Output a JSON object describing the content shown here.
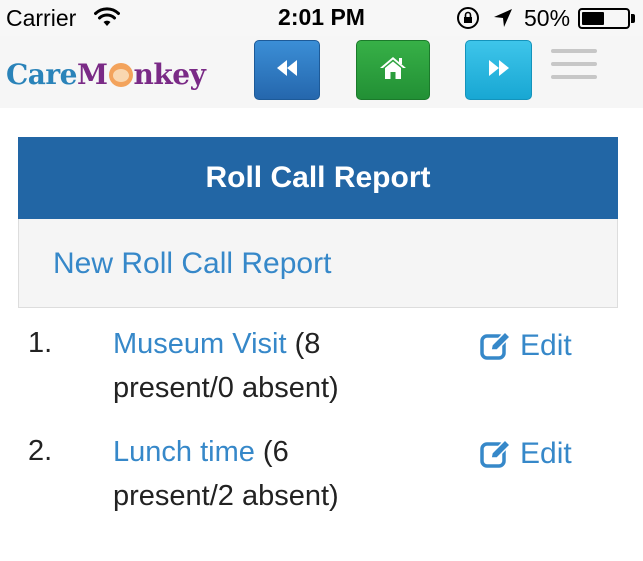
{
  "status_bar": {
    "carrier": "Carrier",
    "time": "2:01 PM",
    "battery_percent": "50%",
    "battery_level": 0.5,
    "icons": [
      "wifi-icon",
      "orientation-lock-icon",
      "location-arrow-icon",
      "battery-icon"
    ]
  },
  "nav": {
    "logo_part1": "Care",
    "logo_part2": "M",
    "logo_part3": "nkey",
    "buttons": [
      "back-icon",
      "home-icon",
      "forward-icon",
      "hamburger-menu-icon"
    ]
  },
  "panel": {
    "title": "Roll Call Report",
    "new_link": "New Roll Call Report"
  },
  "reports": [
    {
      "number": "1.",
      "name": "Museum Visit",
      "detail": " (8 present/0 absent)",
      "edit_label": "Edit"
    },
    {
      "number": "2.",
      "name": "Lunch time",
      "detail": " (6 present/2 absent)",
      "edit_label": "Edit"
    }
  ],
  "colors": {
    "brand_blue": "#2266a5",
    "link_blue": "#3688c9",
    "home_green": "#229035",
    "forward_cyan": "#18a7d3"
  }
}
